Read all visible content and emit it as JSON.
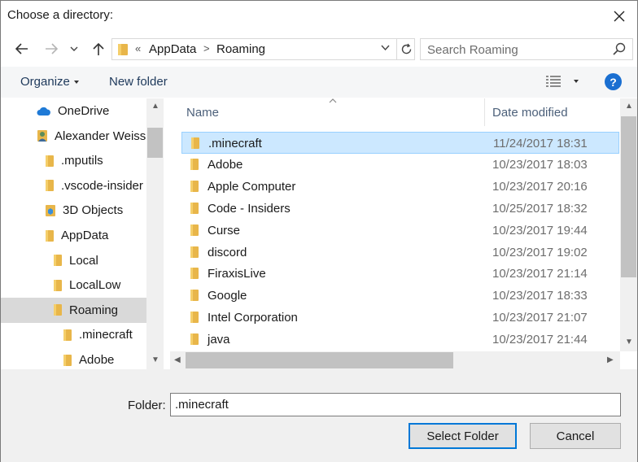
{
  "window": {
    "title": "Choose a directory:"
  },
  "address": {
    "overflow": "«",
    "crumbs": [
      "AppData",
      "Roaming"
    ],
    "separator": ">"
  },
  "search": {
    "placeholder": "Search Roaming"
  },
  "toolbar": {
    "organize": "Organize",
    "new_folder": "New folder",
    "help": "?"
  },
  "nav": {
    "items": [
      {
        "label": "OneDrive",
        "icon": "cloud-icon"
      },
      {
        "label": "Alexander Weiss",
        "icon": "user-icon"
      },
      {
        "label": ".mputils",
        "icon": "folder-icon"
      },
      {
        "label": ".vscode-insider",
        "icon": "folder-icon"
      },
      {
        "label": "3D Objects",
        "icon": "3d-objects-icon"
      },
      {
        "label": "AppData",
        "icon": "folder-icon"
      },
      {
        "label": "Local",
        "icon": "folder-icon"
      },
      {
        "label": "LocalLow",
        "icon": "folder-icon"
      },
      {
        "label": "Roaming",
        "icon": "folder-icon",
        "selected": true
      },
      {
        "label": ".minecraft",
        "icon": "folder-icon"
      },
      {
        "label": "Adobe",
        "icon": "folder-icon"
      }
    ]
  },
  "list": {
    "columns": {
      "name": "Name",
      "date": "Date modified"
    },
    "rows": [
      {
        "name": ".minecraft",
        "date": "11/24/2017 18:31",
        "selected": true
      },
      {
        "name": "Adobe",
        "date": "10/23/2017 18:03"
      },
      {
        "name": "Apple Computer",
        "date": "10/23/2017 20:16"
      },
      {
        "name": "Code - Insiders",
        "date": "10/25/2017 18:32"
      },
      {
        "name": "Curse",
        "date": "10/23/2017 19:44"
      },
      {
        "name": "discord",
        "date": "10/23/2017 19:02"
      },
      {
        "name": "FiraxisLive",
        "date": "10/23/2017 21:14"
      },
      {
        "name": "Google",
        "date": "10/23/2017 18:33"
      },
      {
        "name": "Intel Corporation",
        "date": "10/23/2017 21:07"
      },
      {
        "name": "java",
        "date": "10/23/2017 21:44"
      }
    ]
  },
  "footer": {
    "folder_label": "Folder:",
    "folder_value": ".minecraft",
    "select_button": "Select Folder",
    "cancel_button": "Cancel"
  },
  "colors": {
    "selection": "#cce8ff",
    "accent": "#0078d7",
    "folder": "#e8b64a"
  }
}
